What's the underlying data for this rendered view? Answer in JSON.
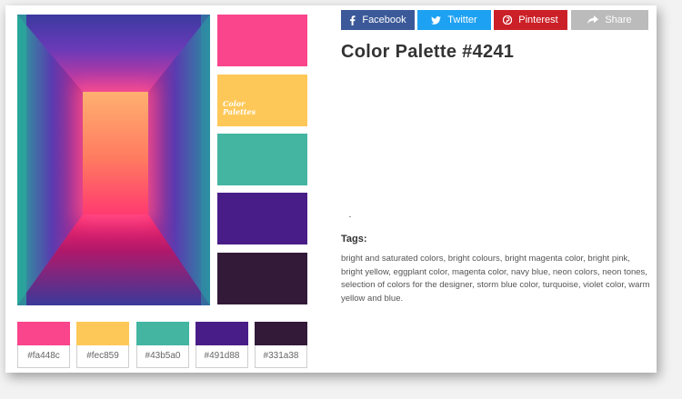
{
  "share": {
    "facebook": {
      "label": "Facebook",
      "color": "#3b5998",
      "icon": "facebook-icon"
    },
    "twitter": {
      "label": "Twitter",
      "color": "#1da1f2",
      "icon": "twitter-icon"
    },
    "pinterest": {
      "label": "Pinterest",
      "color": "#cb2027",
      "icon": "pinterest-icon"
    },
    "share": {
      "label": "Share",
      "color": "#bbbbbb",
      "icon": "share-icon"
    }
  },
  "palette": {
    "title": "Color Palette #4241",
    "brand": "Color Palettes",
    "colors": [
      {
        "hex": "#fa448c",
        "label": "#fa448c"
      },
      {
        "hex": "#fec859",
        "label": "#fec859"
      },
      {
        "hex": "#43b5a0",
        "label": "#43b5a0"
      },
      {
        "hex": "#491d88",
        "label": "#491d88"
      },
      {
        "hex": "#331a38",
        "label": "#331a38"
      }
    ]
  },
  "tags": {
    "label": "Tags:",
    "text": "bright and saturated colors, bright colours, bright magenta color, bright pink, bright yellow, eggplant color, magenta color, navy blue, neon colors, neon tones, selection of colors for the designer, storm blue color, turquoise, violet color, warm yellow and blue."
  }
}
